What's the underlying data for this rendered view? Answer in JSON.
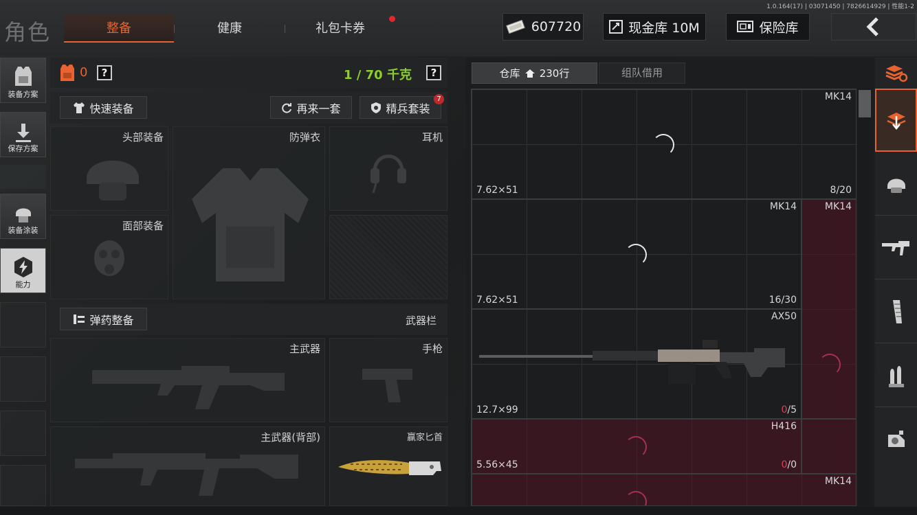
{
  "header": {
    "role": "角色",
    "tabs": [
      {
        "label": "整备",
        "active": true
      },
      {
        "label": "健康",
        "active": false
      },
      {
        "label": "礼包卡券",
        "active": false,
        "dot": true
      }
    ],
    "version": "1.0.164(17) | 03071450 | 7826614929 | 性能1-2",
    "money": "607720",
    "cash_vault": "现金库 10M",
    "safe": "保险库",
    "back_icon": "chevron-left-icon"
  },
  "sidebar": {
    "items": [
      {
        "label": "装备方案",
        "icon": "vest-plan-icon"
      },
      {
        "label": "保存方案",
        "icon": "download-icon"
      },
      {
        "label": "装备涂装",
        "icon": "helmet-skin-icon"
      },
      {
        "label": "能力",
        "icon": "lightning-icon",
        "active": true
      }
    ]
  },
  "loadout": {
    "armor_count": "0",
    "help1": "?",
    "weight": "1 / 70 千克",
    "help2": "?",
    "quick_equip": "快速装备",
    "again": "再来一套",
    "elite": "精兵套装",
    "elite_badge": "7",
    "slots": {
      "head": "头部装备",
      "armor": "防弹衣",
      "earphone": "耳机",
      "face": "面部装备"
    },
    "ammo_btn": "弹药整备",
    "weapon_bar": "武器栏",
    "weapons": {
      "primary": "主武器",
      "pistol": "手枪",
      "primary_back": "主武器(背部)",
      "knife": "赢家匕首"
    }
  },
  "warehouse": {
    "tab_storage": "仓库",
    "rows": "230行",
    "tab_team": "组队借用",
    "items": [
      {
        "name": "MK14",
        "caliber": "7.62×51",
        "count": "8/20"
      },
      {
        "name": "MK14",
        "caliber": "7.62×51",
        "count": "16/30"
      },
      {
        "name": "MK14",
        "caliber": "",
        "count": ""
      },
      {
        "name": "AX50",
        "caliber": "12.7×99",
        "count_a": "0",
        "count_b": "/5"
      },
      {
        "name": "H416",
        "caliber": "5.56×45",
        "count_a": "0",
        "count_b": "/0"
      },
      {
        "name": "MK14",
        "caliber": "",
        "count": ""
      }
    ]
  },
  "right_tabs": [
    "stack-refresh-icon",
    "storage-import-icon",
    "helmet-icon",
    "rifle-icon",
    "magazine-icon",
    "ammo-icon",
    "scope-icon"
  ],
  "colors": {
    "accent": "#e8632f",
    "weight_green": "#8bcf2a",
    "alert_red": "#e0282e",
    "red_cell": "#501224"
  }
}
